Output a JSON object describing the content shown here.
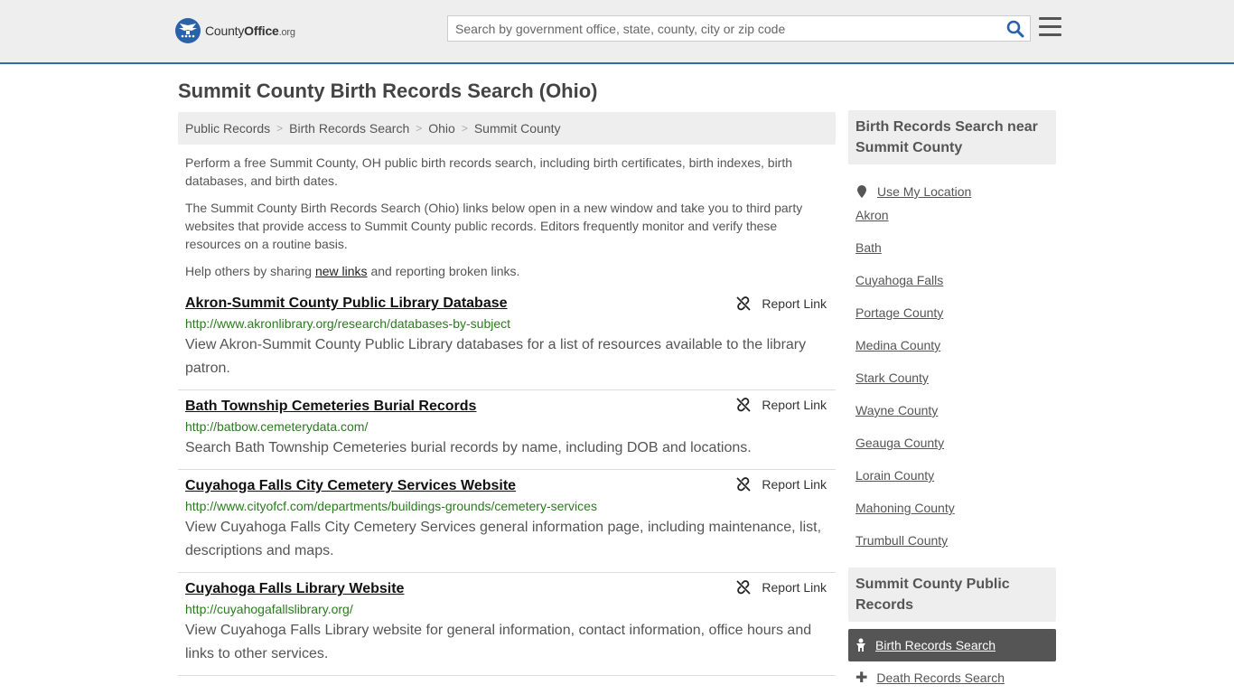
{
  "header": {
    "logo": {
      "county": "County",
      "office": "Office",
      "org": ".org"
    },
    "search": {
      "placeholder": "Search by government office, state, county, city or zip code"
    }
  },
  "page": {
    "title": "Summit County Birth Records Search (Ohio)"
  },
  "breadcrumb": [
    "Public Records",
    "Birth Records Search",
    "Ohio",
    "Summit County"
  ],
  "intro": {
    "p1": "Perform a free Summit County, OH public birth records search, including birth certificates, birth indexes, birth databases, and birth dates.",
    "p2": "The Summit County Birth Records Search (Ohio) links below open in a new window and take you to third party websites that provide access to Summit County public records. Editors frequently monitor and verify these resources on a routine basis.",
    "p3_before": "Help others by sharing ",
    "p3_link": "new links",
    "p3_after": " and reporting broken links."
  },
  "report_label": "Report Link",
  "records": [
    {
      "title": "Akron-Summit County Public Library Database",
      "url": "http://www.akronlibrary.org/research/databases-by-subject",
      "desc": "View Akron-Summit County Public Library databases for a list of resources available to the library patron."
    },
    {
      "title": "Bath Township Cemeteries Burial Records",
      "url": "http://batbow.cemeterydata.com/",
      "desc": "Search Bath Township Cemeteries burial records by name, including DOB and locations."
    },
    {
      "title": "Cuyahoga Falls City Cemetery Services Website",
      "url": "http://www.cityofcf.com/departments/buildings-grounds/cemetery-services",
      "desc": "View Cuyahoga Falls City Cemetery Services general information page, including maintenance, list, descriptions and maps."
    },
    {
      "title": "Cuyahoga Falls Library Website",
      "url": "http://cuyahogafallslibrary.org/",
      "desc": "View Cuyahoga Falls Library website for general information, contact information, office hours and links to other services."
    }
  ],
  "sidebar": {
    "nearby_heading": "Birth Records Search near Summit County",
    "use_location": "Use My Location",
    "nearby": [
      "Akron",
      "Bath",
      "Cuyahoga Falls",
      "Portage County",
      "Medina County",
      "Stark County",
      "Wayne County",
      "Geauga County",
      "Lorain County",
      "Mahoning County",
      "Trumbull County"
    ],
    "public_heading": "Summit County Public Records",
    "active_item": "Birth Records Search",
    "next_item": "Death Records Search"
  },
  "colors": {
    "accent": "#2d6cb5",
    "url_green": "#2b7a1f",
    "active_bg": "#555555"
  }
}
